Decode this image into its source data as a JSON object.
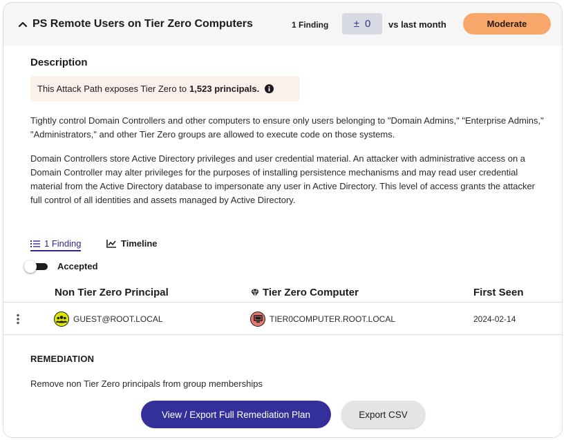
{
  "header": {
    "title": "PS Remote Users on Tier Zero Computers",
    "finding_count": "1 Finding",
    "delta_sign": "±",
    "delta_value": "0",
    "delta_label": "vs last month",
    "severity": "Moderate"
  },
  "description": {
    "heading": "Description",
    "exposure_prefix": "This Attack Path exposes Tier Zero to",
    "exposure_value": "1,523 principals.",
    "paragraph1": "Tightly control Domain Controllers and other computers to ensure only users belonging to \"Domain Admins,\" \"Enterprise Admins,\" \"Administrators,\" and other Tier Zero groups are allowed to execute code on those systems.",
    "paragraph2": "Domain Controllers store Active Directory privileges and user credential material. An attacker with administrative access on a Domain Controller may alter privileges for the purposes of installing persistence mechanisms and may read user credential material from the Active Directory database to impersonate any user in Active Directory. This level of access grants the attacker full control of all identities and assets managed by Active Directory."
  },
  "tabs": [
    {
      "label": "1 Finding",
      "icon": "list-icon",
      "active": true
    },
    {
      "label": "Timeline",
      "icon": "line-chart-icon",
      "active": false
    }
  ],
  "filter": {
    "label": "Accepted",
    "enabled": false
  },
  "table": {
    "columns": [
      "Non Tier Zero Principal",
      "Tier Zero Computer",
      "First Seen"
    ],
    "rows": [
      {
        "principal": "GUEST@ROOT.LOCAL",
        "computer": "TIER0COMPUTER.ROOT.LOCAL",
        "first_seen": "2024-02-14"
      }
    ]
  },
  "remediation": {
    "heading": "REMEDIATION",
    "text": "Remove non Tier Zero principals from group memberships",
    "primary_button": "View / Export Full Remediation Plan",
    "secondary_button": "Export CSV"
  },
  "colors": {
    "accent": "#33309a",
    "severity_moderate": "#f8a76b",
    "group_node": "#dbe500",
    "computer_node": "#e3786e"
  }
}
